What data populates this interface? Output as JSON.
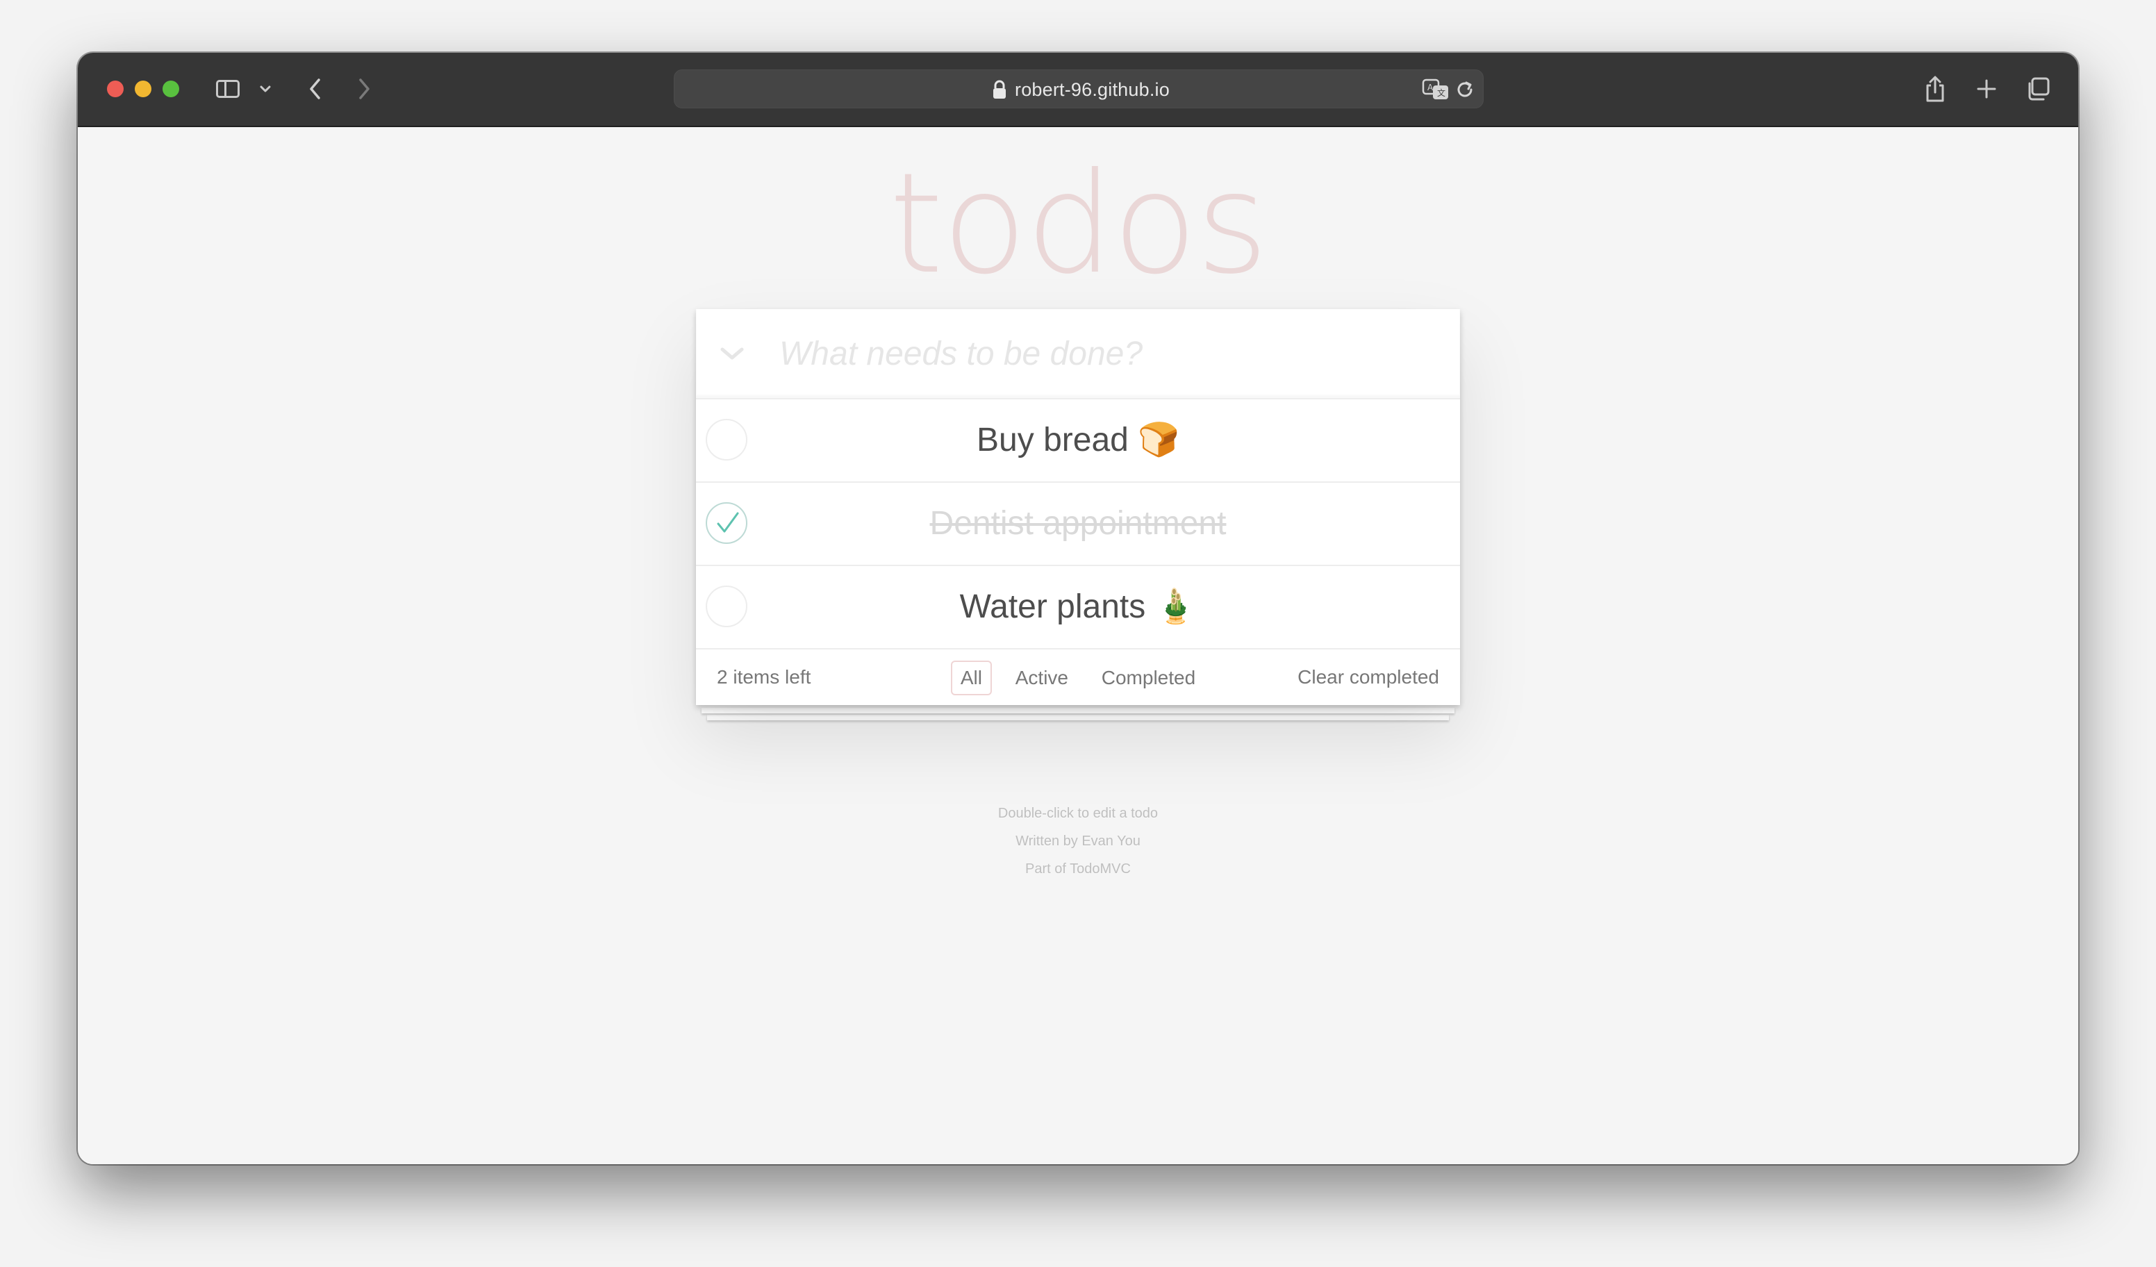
{
  "browser": {
    "url": "robert-96.github.io",
    "icons": {
      "sidebar": "sidebar-icon",
      "tab_overview": "chevron-down-icon",
      "back": "chevron-left-icon",
      "forward": "chevron-right-icon",
      "lock": "lock-icon",
      "translate": "translate-icon",
      "reload": "reload-icon",
      "share": "share-icon",
      "new_tab": "plus-icon",
      "tabs": "tabs-icon"
    }
  },
  "app": {
    "title": "todos",
    "new_todo_placeholder": "What needs to be done?",
    "todos": [
      {
        "label": "Buy bread 🍞",
        "completed": false
      },
      {
        "label": "Dentist appointment",
        "completed": true
      },
      {
        "label": "Water plants 🎍",
        "completed": false
      }
    ],
    "footer": {
      "count_text": "2 items left",
      "filters": [
        "All",
        "Active",
        "Completed"
      ],
      "selected_filter": "All",
      "clear_completed": "Clear completed"
    },
    "info": [
      "Double-click to edit a todo",
      "Written by Evan You",
      "Part of TodoMVC"
    ],
    "colors": {
      "title": "#eadbdb",
      "check": "#5dc2af",
      "background": "#f5f5f5"
    }
  }
}
